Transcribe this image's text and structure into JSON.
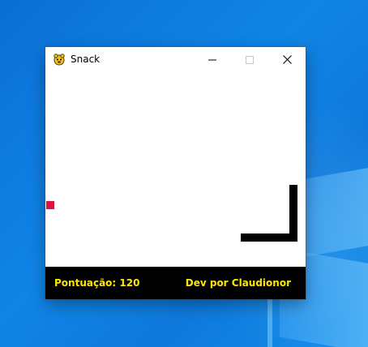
{
  "window": {
    "title": "Snack",
    "icon": "pygame-snake-icon",
    "controls": {
      "minimize": "minimize-icon",
      "maximize": "maximize-icon",
      "close": "close-icon"
    }
  },
  "game": {
    "food_color": "#dc143c",
    "snake_color": "#000000",
    "background": "#ffffff"
  },
  "status": {
    "score_text": "Pontuação: 120",
    "credit_text": "Dev por Claudionor",
    "text_color": "#ffe600",
    "background": "#000000"
  }
}
